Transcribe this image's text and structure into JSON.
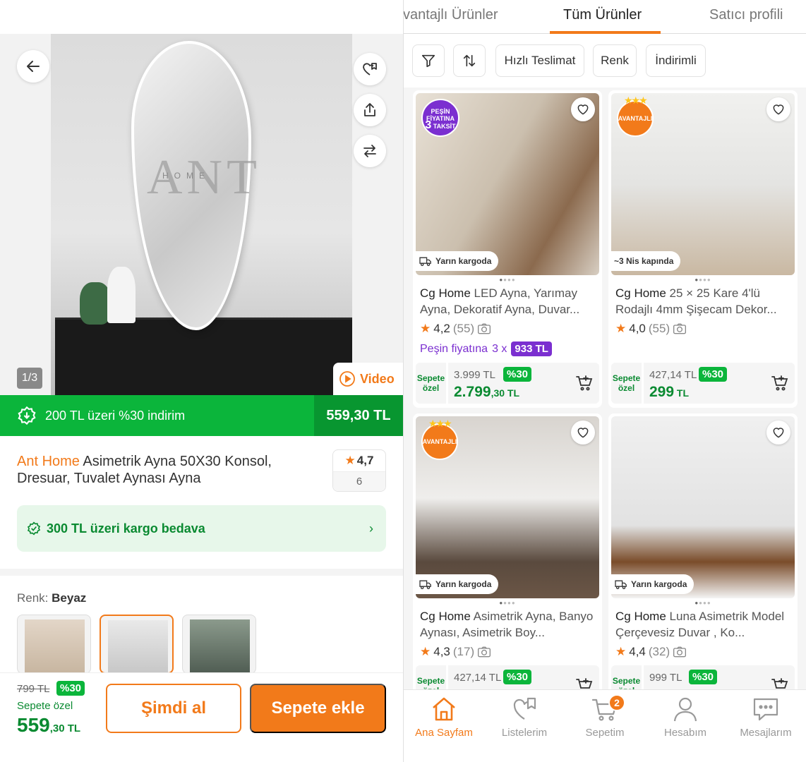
{
  "product": {
    "image_counter": "1/3",
    "video_label": "Video",
    "watermark": "ANT",
    "watermark_sub": "HOME",
    "discount_text": "200 TL üzeri %30 indirim",
    "discount_price": "559,30 TL",
    "brand": "Ant Home",
    "title": " Asimetrik Ayna 50X30 Konsol, Dresuar, Tuvalet Aynası   Ayna",
    "rating": "4,7",
    "rating_count": "6",
    "cargo_text": "300 TL üzeri kargo bedava",
    "color_label": "Renk:",
    "color_value": "Beyaz",
    "old_price": "799 TL",
    "discount_pct": "%30",
    "special_label": "Sepete özel",
    "price_int": "559",
    "price_dec": ",30 TL",
    "buy_now": "Şimdi al",
    "add_to_cart": "Sepete ekle"
  },
  "tabs": [
    {
      "label": "Avantajlı Ürünler"
    },
    {
      "label": "Tüm Ürünler"
    },
    {
      "label": "Satıcı profili"
    }
  ],
  "filters": [
    {
      "label": "Hızlı Teslimat"
    },
    {
      "label": "Renk"
    },
    {
      "label": "İndirimli"
    }
  ],
  "cards": [
    {
      "badge": "PEŞİN FİYATINA 3 TAKSİT",
      "badge_top": "PEŞİN FİYATINA",
      "badge_num": "3",
      "badge_bottom": "TAKSİT",
      "ship": "Yarın kargoda",
      "brand": "Cg Home",
      "title": " LED Ayna, Yarımay Ayna, Dekoratif Ayna, Duvar...",
      "rating": "4,2",
      "count": "(55)",
      "pesin_label": "Peşin fiyatına",
      "pesin_x": "3 x",
      "pesin_amount": "933 TL",
      "special": "Sepete özel",
      "old": "3.999 TL",
      "pct": "%30",
      "price_int": "2.799",
      "price_dec": ",30 TL"
    },
    {
      "badge": "AVANTAJLI",
      "ship": "~3 Nis kapında",
      "brand": "Cg Home",
      "title": " 25  ×  25 Kare 4'lü Rodajlı 4mm Şişecam Dekor...",
      "rating": "4,0",
      "count": "(55)",
      "special": "Sepete özel",
      "old": "427,14 TL",
      "pct": "%30",
      "price_int": "299",
      "price_dec": " TL"
    },
    {
      "badge": "AVANTAJLI",
      "ship": "Yarın kargoda",
      "brand": "Cg Home",
      "title": " Asimetrik Ayna, Banyo Aynası, Asimetrik Boy...",
      "rating": "4,3",
      "count": "(17)",
      "special": "Sepete özel",
      "old": "427,14 TL",
      "pct": "%30"
    },
    {
      "ship": "Yarın kargoda",
      "brand": "Cg Home",
      "title": " Luna Asimetrik Model Çerçevesiz Duvar , Ko...",
      "rating": "4,4",
      "count": "(32)",
      "special": "Sepete özel",
      "old": "999 TL",
      "pct": "%30"
    }
  ],
  "tabbar": [
    {
      "label": "Ana Sayfam",
      "icon": "home-icon"
    },
    {
      "label": "Listelerim",
      "icon": "heart-list-icon"
    },
    {
      "label": "Sepetim",
      "icon": "cart-icon",
      "badge": "2"
    },
    {
      "label": "Hesabım",
      "icon": "user-icon"
    },
    {
      "label": "Mesajlarım",
      "icon": "message-icon"
    }
  ],
  "colors": {
    "accent": "#f27a1a",
    "green": "#0bb53b",
    "dark_green": "#0a8a31",
    "purple": "#7b2fd0"
  }
}
